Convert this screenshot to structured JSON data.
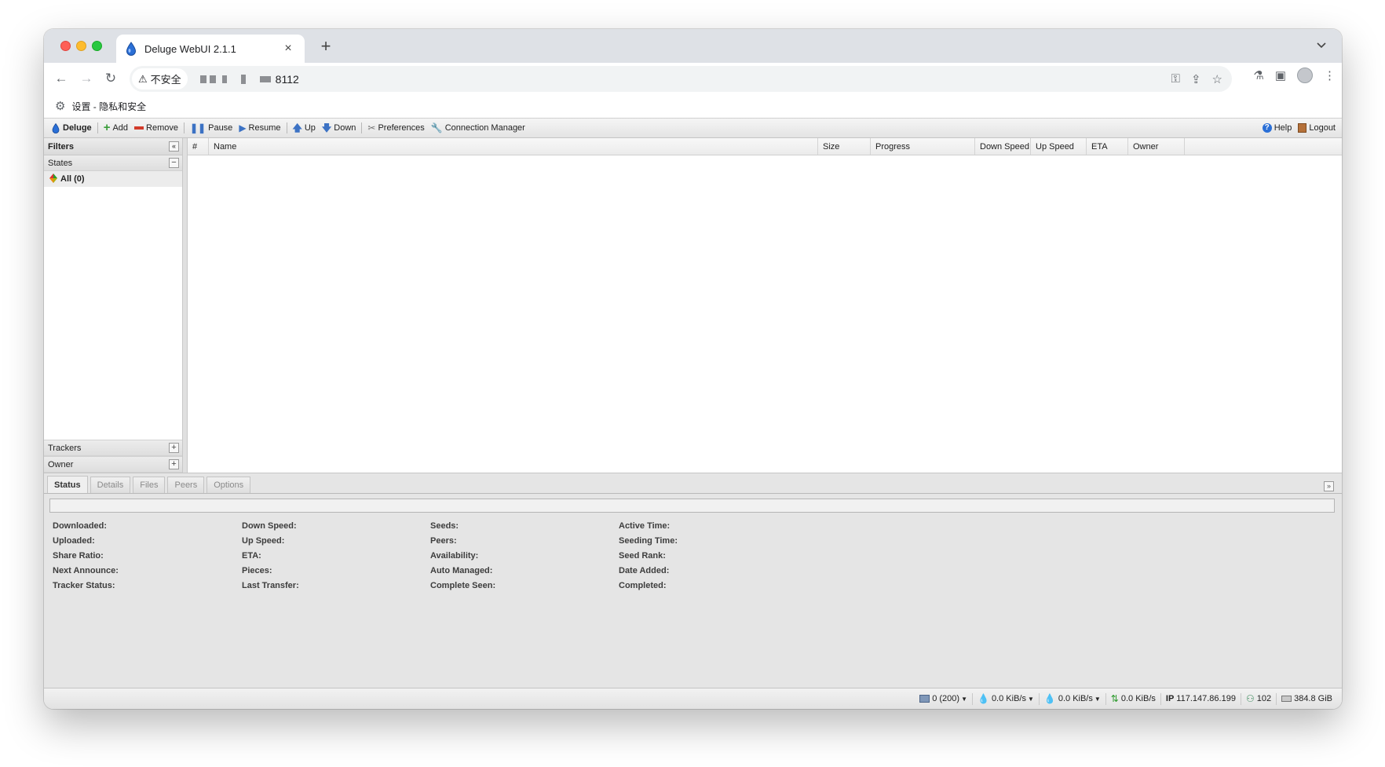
{
  "browser": {
    "tab_title": "Deluge WebUI 2.1.1",
    "tab_close": "×",
    "new_tab": "+",
    "tablist_toggle": "⌄",
    "security_label": "不安全",
    "url_port": "8112",
    "bookmark_label": "设置 - 隐私和安全"
  },
  "toolbar": {
    "brand": "Deluge",
    "add": "Add",
    "remove": "Remove",
    "pause": "Pause",
    "resume": "Resume",
    "up": "Up",
    "down": "Down",
    "preferences": "Preferences",
    "connection_manager": "Connection Manager",
    "help": "Help",
    "logout": "Logout"
  },
  "filters": {
    "title": "Filters",
    "states_label": "States",
    "all_item": "All (0)",
    "trackers_label": "Trackers",
    "owner_label": "Owner"
  },
  "grid": {
    "columns": [
      "#",
      "Name",
      "Size",
      "Progress",
      "Down Speed",
      "Up Speed",
      "ETA",
      "Owner"
    ]
  },
  "details": {
    "tabs": [
      "Status",
      "Details",
      "Files",
      "Peers",
      "Options"
    ],
    "col1": [
      "Downloaded:",
      "Uploaded:",
      "Share Ratio:",
      "Next Announce:",
      "Tracker Status:"
    ],
    "col2": [
      "Down Speed:",
      "Up Speed:",
      "ETA:",
      "Pieces:",
      "Last Transfer:"
    ],
    "col3": [
      "Seeds:",
      "Peers:",
      "Availability:",
      "Auto Managed:",
      "Complete Seen:"
    ],
    "col4": [
      "Active Time:",
      "Seeding Time:",
      "Seed Rank:",
      "Date Added:",
      "Completed:"
    ]
  },
  "statusbar": {
    "connections": "0 (200)",
    "down_speed": "0.0 KiB/s",
    "up_speed": "0.0 KiB/s",
    "protocol": "0.0 KiB/s",
    "ip_label": "IP",
    "ip_value": "117.147.86.199",
    "dht_nodes": "102",
    "free_space": "384.8 GiB"
  },
  "colors": {
    "accent_blue": "#1f64c8",
    "remove_red": "#d23b2b",
    "add_green": "#3a9d3a"
  }
}
